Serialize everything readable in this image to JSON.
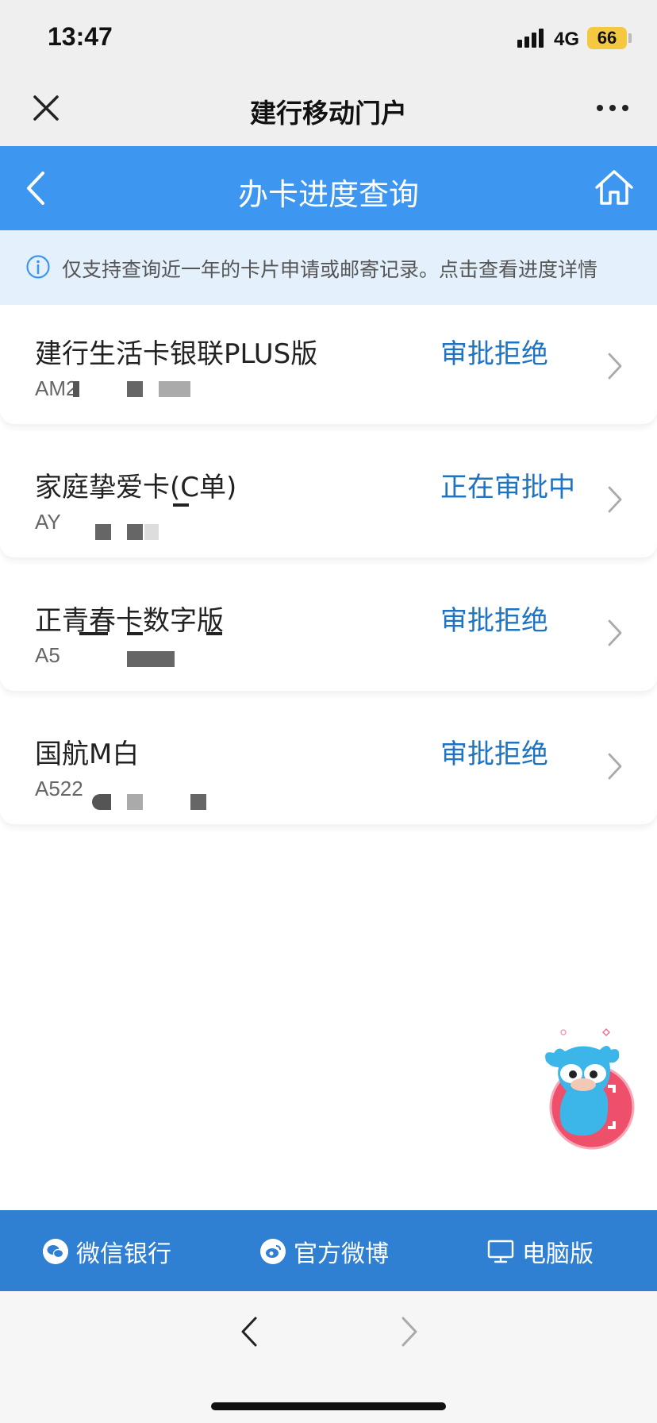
{
  "status_bar": {
    "time": "13:47",
    "network": "4G",
    "battery": "66"
  },
  "app_header": {
    "title": "建行移动门户",
    "close_icon": "close-icon",
    "more_icon": "more-icon"
  },
  "nav": {
    "title": "办卡进度查询",
    "back_icon": "back-icon",
    "home_icon": "home-icon"
  },
  "notice": {
    "text": "仅支持查询近一年的卡片申请或邮寄记录。点击查看进度详情",
    "icon": "info-icon"
  },
  "cards": [
    {
      "name": "建行生活卡银联PLUS版",
      "id": "AM2",
      "status": "审批拒绝"
    },
    {
      "name": "家庭挚爱卡(C单)",
      "id": "AY",
      "status": "正在审批中"
    },
    {
      "name": "正青春卡数字版",
      "id": "A5",
      "status": "审批拒绝"
    },
    {
      "name": "国航M白",
      "id": "A522",
      "status": "审批拒绝"
    }
  ],
  "footer": {
    "links": [
      {
        "label": "微信银行",
        "icon": "wechat-icon"
      },
      {
        "label": "官方微博",
        "icon": "weibo-icon"
      },
      {
        "label": "电脑版",
        "icon": "desktop-icon"
      }
    ]
  },
  "colors": {
    "nav_blue": "#3d96f0",
    "footer_blue": "#2f7fd2",
    "status_blue": "#1e73c2",
    "notice_bg": "#e4f1fc"
  }
}
